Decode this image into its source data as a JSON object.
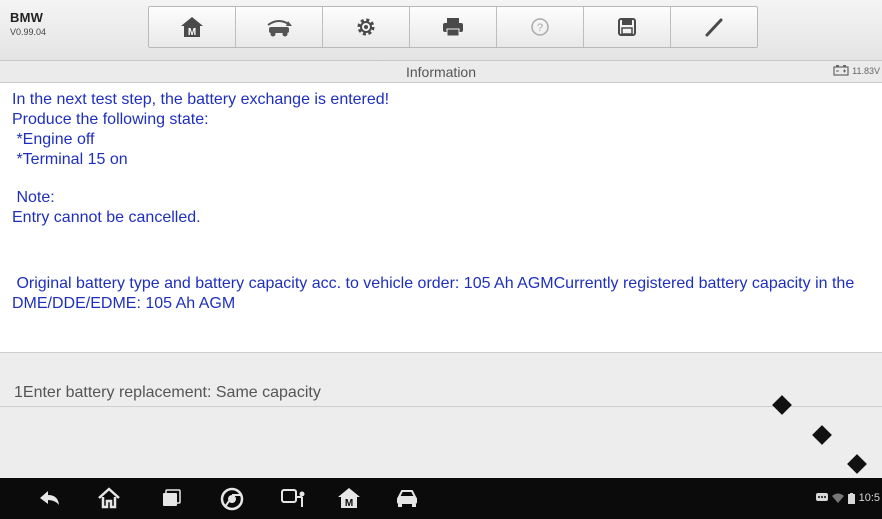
{
  "brand": {
    "name": "BMW",
    "version": "V0.99.04"
  },
  "toolbar": {
    "tools": [
      {
        "icon": "home-icon"
      },
      {
        "icon": "vehicle-swap-icon"
      },
      {
        "icon": "gear-icon"
      },
      {
        "icon": "printer-icon"
      },
      {
        "icon": "help-icon"
      },
      {
        "icon": "save-icon"
      },
      {
        "icon": "pen-icon"
      }
    ]
  },
  "info": {
    "title": "Information",
    "battery_voltage": "11.83V"
  },
  "message": {
    "lines": [
      "In the next test step, the battery exchange is entered!",
      "Produce the following state:",
      " *Engine off",
      " *Terminal 15 on",
      " Note:",
      "Entry cannot be cancelled.",
      " Original battery type and battery capacity acc. to vehicle order: 105 Ah AGMCurrently registered battery capacity in the DME/DDE/EDME: 105 Ah AGM"
    ]
  },
  "options": [
    {
      "label": "1Enter battery replacement: Same capacity"
    }
  ],
  "navbar": {
    "icons": [
      "back-icon",
      "home-icon",
      "recent-apps-icon",
      "chrome-icon",
      "vci-connect-icon",
      "autel-home-icon",
      "car-icon"
    ],
    "clock": "10:5"
  },
  "colors": {
    "message_text": "#1f2fbd",
    "navbar_bg": "#0b0b0b"
  }
}
